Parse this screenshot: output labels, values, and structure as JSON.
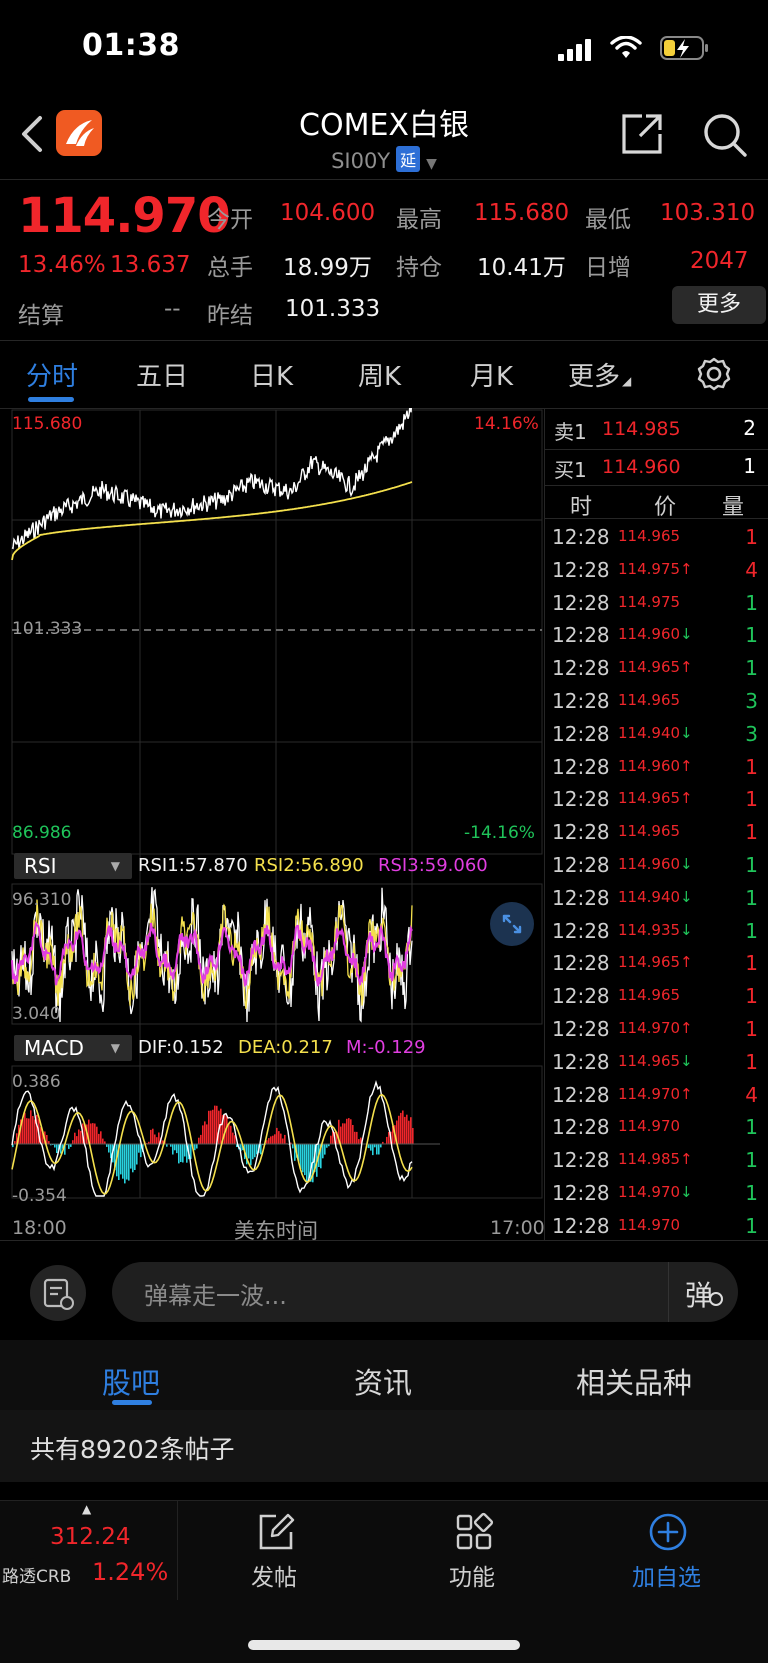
{
  "status_bar": {
    "time": "01:38"
  },
  "header": {
    "title": "COMEX白银",
    "symbol": "SI00Y",
    "delay_badge": "延"
  },
  "quote": {
    "price": "114.970",
    "change_pct": "13.46%",
    "change": "13.637",
    "open_label": "今开",
    "open": "104.600",
    "high_label": "最高",
    "high": "115.680",
    "low_label": "最低",
    "low": "103.310",
    "volume_label": "总手",
    "volume": "18.99万",
    "oi_label": "持仓",
    "oi": "10.41万",
    "daily_inc_label": "日增",
    "daily_inc": "2047",
    "settle_label": "结算",
    "settle": "--",
    "prev_settle_label": "昨结",
    "prev_settle": "101.333",
    "more_label": "更多"
  },
  "tabs": [
    "分时",
    "五日",
    "日K",
    "周K",
    "月K",
    "更多"
  ],
  "chart": {
    "y_top": "115.680",
    "y_top_pct": "14.16%",
    "y_mid": "101.333",
    "y_bottom": "86.986",
    "y_bottom_pct": "-14.16%",
    "x_start": "18:00",
    "x_mid": "美东时间",
    "x_end": "17:00"
  },
  "rsi": {
    "name": "RSI",
    "rsi1": "RSI1:57.870",
    "rsi2": "RSI2:56.890",
    "rsi3": "RSI3:59.060",
    "top": "96.310",
    "bottom": "3.040"
  },
  "macd": {
    "name": "MACD",
    "dif": "DIF:0.152",
    "dea": "DEA:0.217",
    "m": "M:-0.129",
    "top": "0.386",
    "bottom": "-0.354"
  },
  "order_book": {
    "ask_label": "卖1",
    "ask_price": "114.985",
    "ask_qty": "2",
    "bid_label": "买1",
    "bid_price": "114.960",
    "bid_qty": "1",
    "col_time": "时",
    "col_price": "价",
    "col_qty": "量"
  },
  "ticks": [
    {
      "time": "12:28",
      "price": "114.965",
      "arrow": "",
      "qty": "1",
      "qty_color": "red"
    },
    {
      "time": "12:28",
      "price": "114.975",
      "arrow": "↑",
      "qty": "4",
      "qty_color": "red"
    },
    {
      "time": "12:28",
      "price": "114.975",
      "arrow": "",
      "qty": "1",
      "qty_color": "green"
    },
    {
      "time": "12:28",
      "price": "114.960",
      "arrow": "↓",
      "qty": "1",
      "qty_color": "green"
    },
    {
      "time": "12:28",
      "price": "114.965",
      "arrow": "↑",
      "qty": "1",
      "qty_color": "green"
    },
    {
      "time": "12:28",
      "price": "114.965",
      "arrow": "",
      "qty": "3",
      "qty_color": "green"
    },
    {
      "time": "12:28",
      "price": "114.940",
      "arrow": "↓",
      "qty": "3",
      "qty_color": "green"
    },
    {
      "time": "12:28",
      "price": "114.960",
      "arrow": "↑",
      "qty": "1",
      "qty_color": "red"
    },
    {
      "time": "12:28",
      "price": "114.965",
      "arrow": "↑",
      "qty": "1",
      "qty_color": "red"
    },
    {
      "time": "12:28",
      "price": "114.965",
      "arrow": "",
      "qty": "1",
      "qty_color": "red"
    },
    {
      "time": "12:28",
      "price": "114.960",
      "arrow": "↓",
      "qty": "1",
      "qty_color": "green"
    },
    {
      "time": "12:28",
      "price": "114.940",
      "arrow": "↓",
      "qty": "1",
      "qty_color": "green"
    },
    {
      "time": "12:28",
      "price": "114.935",
      "arrow": "↓",
      "qty": "1",
      "qty_color": "green"
    },
    {
      "time": "12:28",
      "price": "114.965",
      "arrow": "↑",
      "qty": "1",
      "qty_color": "red"
    },
    {
      "time": "12:28",
      "price": "114.965",
      "arrow": "",
      "qty": "1",
      "qty_color": "red"
    },
    {
      "time": "12:28",
      "price": "114.970",
      "arrow": "↑",
      "qty": "1",
      "qty_color": "red"
    },
    {
      "time": "12:28",
      "price": "114.965",
      "arrow": "↓",
      "qty": "1",
      "qty_color": "red"
    },
    {
      "time": "12:28",
      "price": "114.970",
      "arrow": "↑",
      "qty": "4",
      "qty_color": "red"
    },
    {
      "time": "12:28",
      "price": "114.970",
      "arrow": "",
      "qty": "1",
      "qty_color": "green"
    },
    {
      "time": "12:28",
      "price": "114.985",
      "arrow": "↑",
      "qty": "1",
      "qty_color": "green"
    },
    {
      "time": "12:28",
      "price": "114.970",
      "arrow": "↓",
      "qty": "1",
      "qty_color": "green"
    },
    {
      "time": "12:28",
      "price": "114.970",
      "arrow": "",
      "qty": "1",
      "qty_color": "green"
    }
  ],
  "comment": {
    "placeholder": "弹幕走一波...",
    "danmu_label": "弹"
  },
  "bottom_tabs": [
    "股吧",
    "资讯",
    "相关品种"
  ],
  "posts": {
    "count_text": "共有89202条帖子"
  },
  "bottom_nav": {
    "index_value": "312.24",
    "index_name": "路透CRB",
    "index_pct": "1.24%",
    "post_label": "发帖",
    "func_label": "功能",
    "watch_label": "加自选"
  },
  "colors": {
    "up": "#f0262b",
    "down": "#1fc45a",
    "accent": "#2f7fe0",
    "avg_line": "#f4e04d",
    "rsi3": "#e03ee0",
    "macd_neg": "#29d3df"
  },
  "icons": {
    "back": "back-arrow-icon",
    "logo": "app-logo-icon",
    "share": "share-icon",
    "search": "search-icon",
    "settings": "gear-icon",
    "expand": "expand-icon",
    "comment": "comment-list-icon",
    "post": "edit-icon",
    "function": "grid-icon",
    "watch": "plus-circle-icon"
  }
}
